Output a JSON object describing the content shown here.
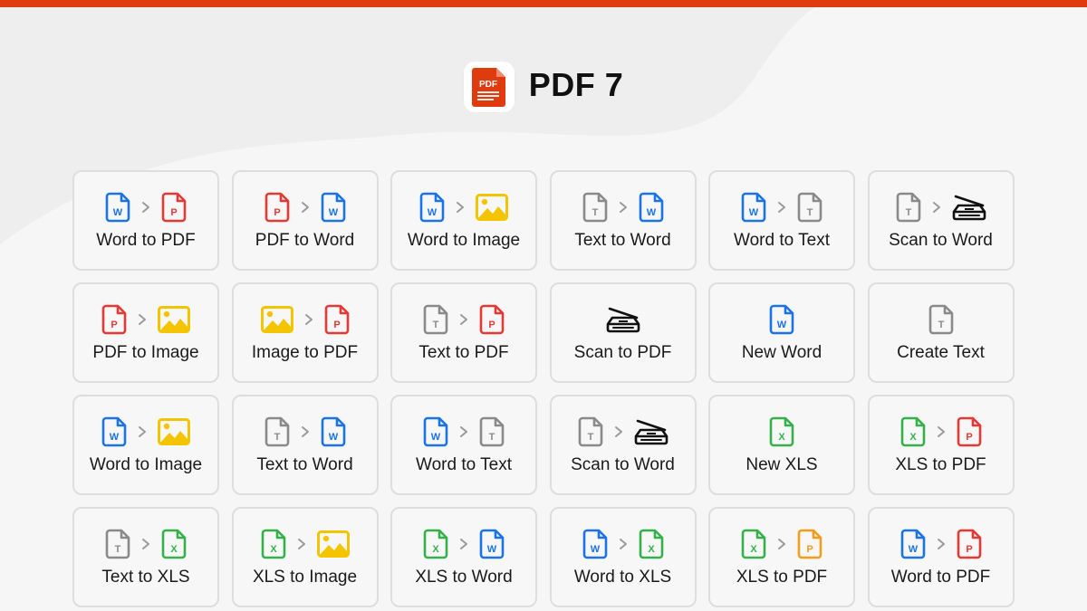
{
  "colors": {
    "accent": "#e03a0f",
    "word": "#1a73e8",
    "pdf": "#e53935",
    "text": "#8a8a8a",
    "xls": "#34b14a",
    "image": "#f5c400",
    "pdf_alt": "#f59c1a",
    "scanner": "#111111"
  },
  "header": {
    "logo_text": "PDF",
    "title": "PDF 7"
  },
  "tiles": [
    {
      "label": "Word to PDF",
      "from": "word",
      "to": "pdf"
    },
    {
      "label": "PDF to Word",
      "from": "pdf",
      "to": "word"
    },
    {
      "label": "Word to Image",
      "from": "word",
      "to": "image"
    },
    {
      "label": "Text to Word",
      "from": "text",
      "to": "word"
    },
    {
      "label": "Word to Text",
      "from": "word",
      "to": "text"
    },
    {
      "label": "Scan to Word",
      "from": "text",
      "to": "scanner"
    },
    {
      "label": "PDF to Image",
      "from": "pdf",
      "to": "image"
    },
    {
      "label": "Image to PDF",
      "from": "image",
      "to": "pdf"
    },
    {
      "label": "Text to PDF",
      "from": "text",
      "to": "pdf"
    },
    {
      "label": "Scan to PDF",
      "from": "scanner",
      "to": null
    },
    {
      "label": "New Word",
      "from": "word",
      "to": null
    },
    {
      "label": "Create Text",
      "from": "text",
      "to": null
    },
    {
      "label": "Word to Image",
      "from": "word",
      "to": "image"
    },
    {
      "label": "Text to Word",
      "from": "text",
      "to": "word"
    },
    {
      "label": "Word to Text",
      "from": "word",
      "to": "text"
    },
    {
      "label": "Scan to Word",
      "from": "text",
      "to": "scanner"
    },
    {
      "label": "New XLS",
      "from": "xls",
      "to": null
    },
    {
      "label": "XLS to PDF",
      "from": "xls",
      "to": "pdf"
    },
    {
      "label": "Text to XLS",
      "from": "text",
      "to": "xls"
    },
    {
      "label": "XLS to Image",
      "from": "xls",
      "to": "image"
    },
    {
      "label": "XLS to Word",
      "from": "xls",
      "to": "word"
    },
    {
      "label": "Word to XLS",
      "from": "word",
      "to": "xls"
    },
    {
      "label": "XLS to PDF",
      "from": "xls",
      "to": "pdf_alt"
    },
    {
      "label": "Word to PDF",
      "from": "word",
      "to": "pdf"
    }
  ],
  "icon_letters": {
    "word": "W",
    "pdf": "P",
    "pdf_alt": "P",
    "text": "T",
    "xls": "X"
  },
  "icon_names": {
    "word": "word-file-icon",
    "pdf": "pdf-file-icon",
    "pdf_alt": "pdf-file-icon",
    "text": "text-file-icon",
    "xls": "xls-file-icon",
    "image": "image-icon",
    "scanner": "scanner-icon",
    "arrow": "chevron-right-icon"
  }
}
